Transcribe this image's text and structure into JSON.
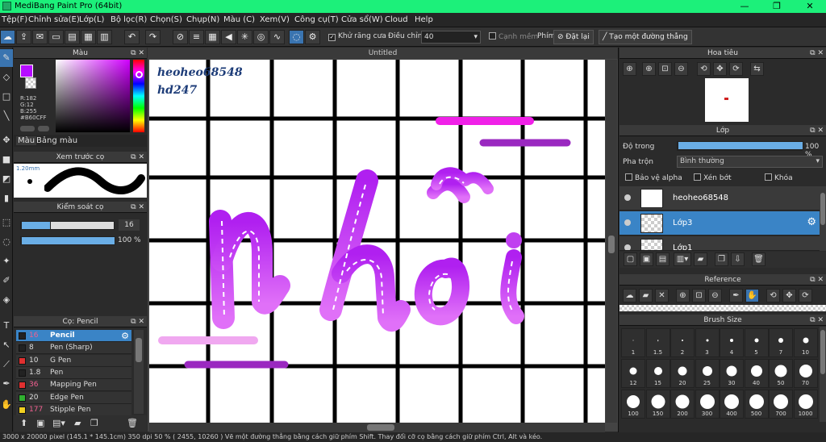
{
  "window": {
    "title": "MediBang Paint Pro (64bit)"
  },
  "menu": [
    "Tệp(F)",
    "Chỉnh sửa(E)",
    "Lớp(L)",
    "Bộ lọc(R)",
    "Chọn(S)",
    "Chụp(N)",
    "Màu (C)",
    "Xem(V)",
    "Công cụ(T)",
    "Cửa sổ(W)",
    "Cloud",
    "Help"
  ],
  "toolbar": {
    "antialias_label": "Khử răng cưa",
    "correction_label": "Điều chỉnh",
    "correction_value": "40",
    "edge_label": "Cạnh mềm",
    "keys_label": "Phím",
    "reset_label": "Đặt lại",
    "line_label": "Tạo một đường thẳng"
  },
  "color_panel": {
    "title": "Màu",
    "rgb_r": "R:182",
    "rgb_g": "G:12",
    "rgb_b": "B:255",
    "hex": "#B60CFF",
    "tab_color": "Màu",
    "tab_palette": "Bảng màu",
    "primary_color": "#B60CFF"
  },
  "brush_preview": {
    "title": "Xem trước cọ",
    "size": "1.20mm"
  },
  "brush_control": {
    "title": "Kiểm soát cọ",
    "size_value": "16",
    "opacity_value": "100 %",
    "size_fraction": 0.32,
    "opacity_fraction": 1.0
  },
  "brush_list": {
    "title": "Cọ: Pencil",
    "items": [
      {
        "size": "16",
        "name": "Pencil",
        "color": "#222222"
      },
      {
        "size": "8",
        "name": "Pen (Sharp)",
        "color": "#222222"
      },
      {
        "size": "10",
        "name": "G Pen",
        "color": "#e03030"
      },
      {
        "size": "1.8",
        "name": "Pen",
        "color": "#222222"
      },
      {
        "size": "36",
        "name": "Mapping Pen",
        "color": "#e03030"
      },
      {
        "size": "20",
        "name": "Edge Pen",
        "color": "#30b030"
      },
      {
        "size": "177",
        "name": "Stipple Pen",
        "color": "#f0d020"
      }
    ]
  },
  "canvas": {
    "title": "Untitled",
    "watermark_line1": "heoheo68548",
    "watermark_line2": "hd247"
  },
  "navigator": {
    "title": "Hoa tiêu"
  },
  "layers": {
    "title": "Lớp",
    "opacity_label": "Độ trong",
    "opacity_value": "100 %",
    "opacity_fraction": 1.0,
    "blend_label": "Pha trộn",
    "blend_value": "Bình thường",
    "protect_alpha": "Bảo vệ alpha",
    "clipping": "Xén bớt",
    "lock": "Khóa",
    "items": [
      {
        "name": "heoheo68548"
      },
      {
        "name": "Lớp3"
      },
      {
        "name": "Lớp1"
      }
    ]
  },
  "reference": {
    "title": "Reference"
  },
  "brush_size": {
    "title": "Brush Size",
    "sizes": [
      "1",
      "1.5",
      "2",
      "3",
      "4",
      "5",
      "7",
      "10",
      "12",
      "15",
      "20",
      "25",
      "30",
      "40",
      "50",
      "70",
      "100",
      "150",
      "200",
      "300",
      "400",
      "500",
      "700",
      "1000"
    ]
  },
  "status": {
    "text": "3000 x 20000 pixel  (145.1 * 145.1cm)  350 dpi  50 %  ( 2455, 10260 )  Vẽ một đường thẳng bằng cách giữ phím Shift. Thay đổi cỡ cọ bằng cách giữ phím Ctrl, Alt và kéo."
  },
  "icons": {
    "undo": "undo-icon",
    "redo": "redo-icon",
    "gear": "gear-icon",
    "eye": "eye-icon",
    "close": "close-icon",
    "undock": "undock-icon"
  }
}
